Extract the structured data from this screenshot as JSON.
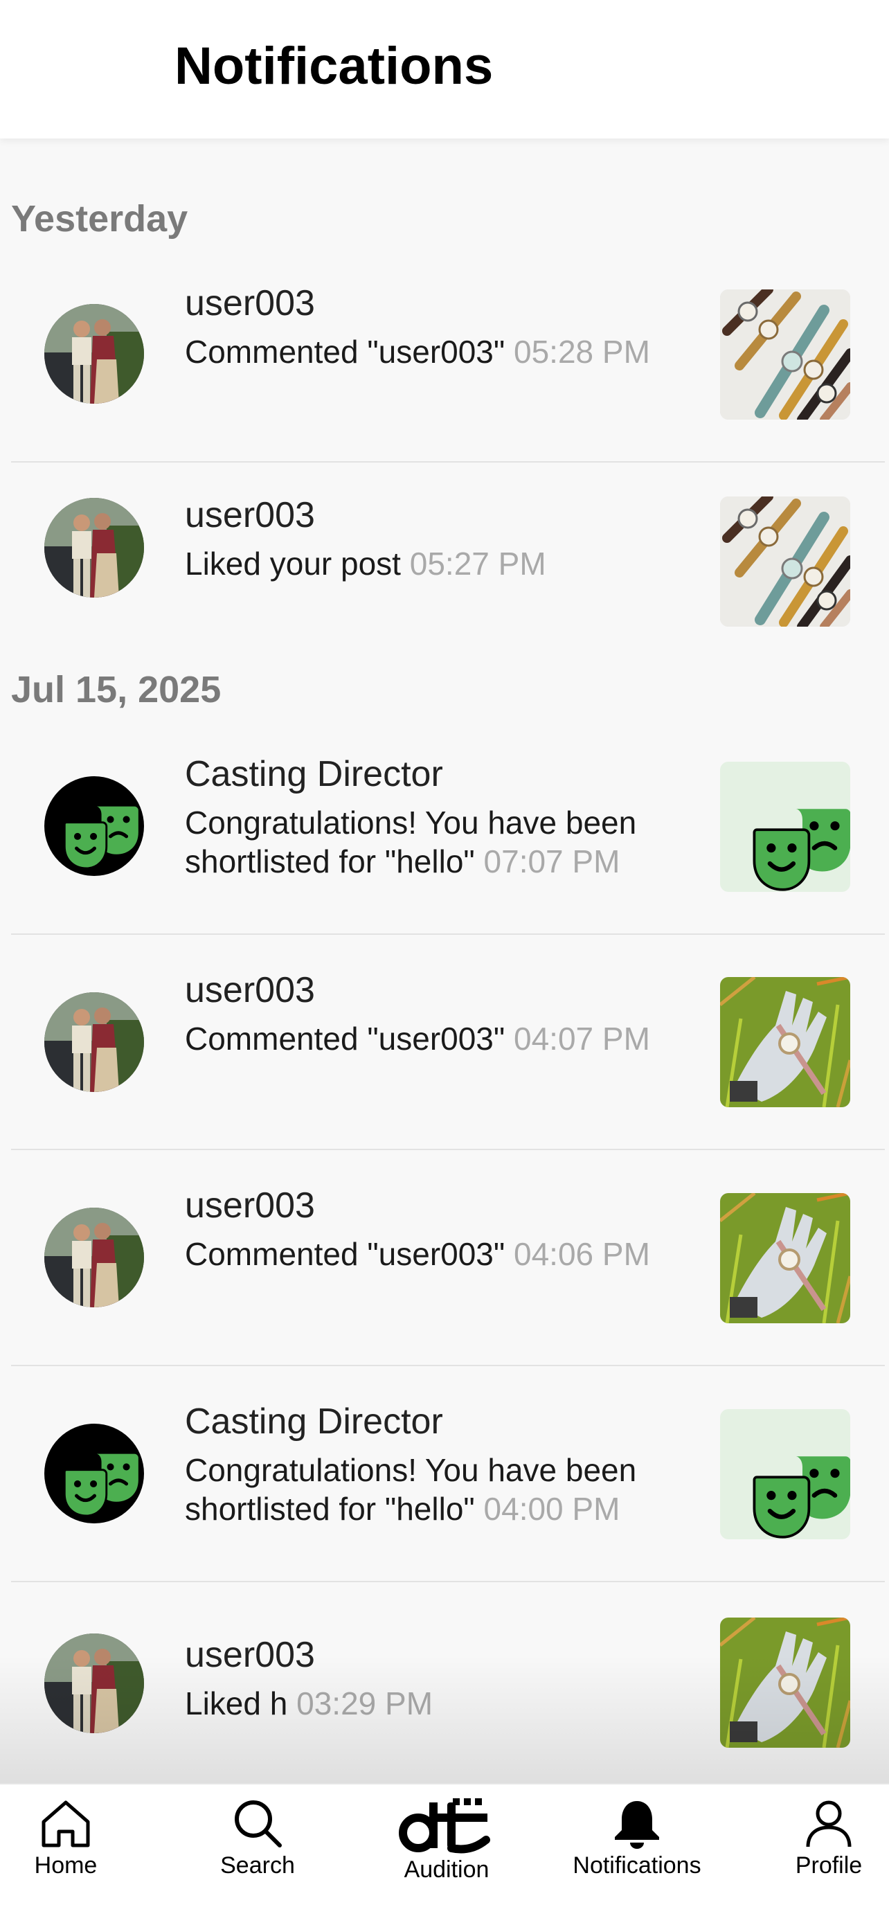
{
  "header": {
    "title": "Notifications"
  },
  "sections": [
    {
      "label": "Yesterday"
    },
    {
      "label": "Jul 15, 2025"
    }
  ],
  "notifications": [
    {
      "user": "user003",
      "message": "Commented \"user003\"",
      "time": "05:28 PM",
      "avatar": "person-photo",
      "thumb": "watches-photo"
    },
    {
      "user": "user003",
      "message": "Liked your post",
      "time": "05:27 PM",
      "avatar": "person-photo",
      "thumb": "watches-photo"
    },
    {
      "user": "Casting Director",
      "message": "Congratulations! You have been shortlisted for \"hello\"",
      "time": "07:07 PM",
      "avatar": "theater-masks-icon",
      "thumb": "theater-masks-icon"
    },
    {
      "user": "user003",
      "message": "Commented \"user003\"",
      "time": "04:07 PM",
      "avatar": "person-photo",
      "thumb": "glove-watch-photo"
    },
    {
      "user": "user003",
      "message": "Commented \"user003\"",
      "time": "04:06 PM",
      "avatar": "person-photo",
      "thumb": "glove-watch-photo"
    },
    {
      "user": "Casting Director",
      "message": "Congratulations! You have been shortlisted for \"hello\"",
      "time": "04:00 PM",
      "avatar": "theater-masks-icon",
      "thumb": "theater-masks-icon"
    },
    {
      "user": "user003",
      "message": "Liked h",
      "time": "03:29 PM",
      "avatar": "person-photo",
      "thumb": "glove-watch-photo"
    }
  ],
  "nav": [
    {
      "label": "Home",
      "icon": "home-icon"
    },
    {
      "label": "Search",
      "icon": "search-icon"
    },
    {
      "label": "Audition",
      "icon": "dt-logo-icon"
    },
    {
      "label": "Notifications",
      "icon": "bell-icon"
    },
    {
      "label": "Profile",
      "icon": "profile-icon"
    }
  ],
  "colors": {
    "accent_green": "#4caf50",
    "mask_tile_bg": "#e4f1e3",
    "time_gray": "#a9a9a9"
  }
}
